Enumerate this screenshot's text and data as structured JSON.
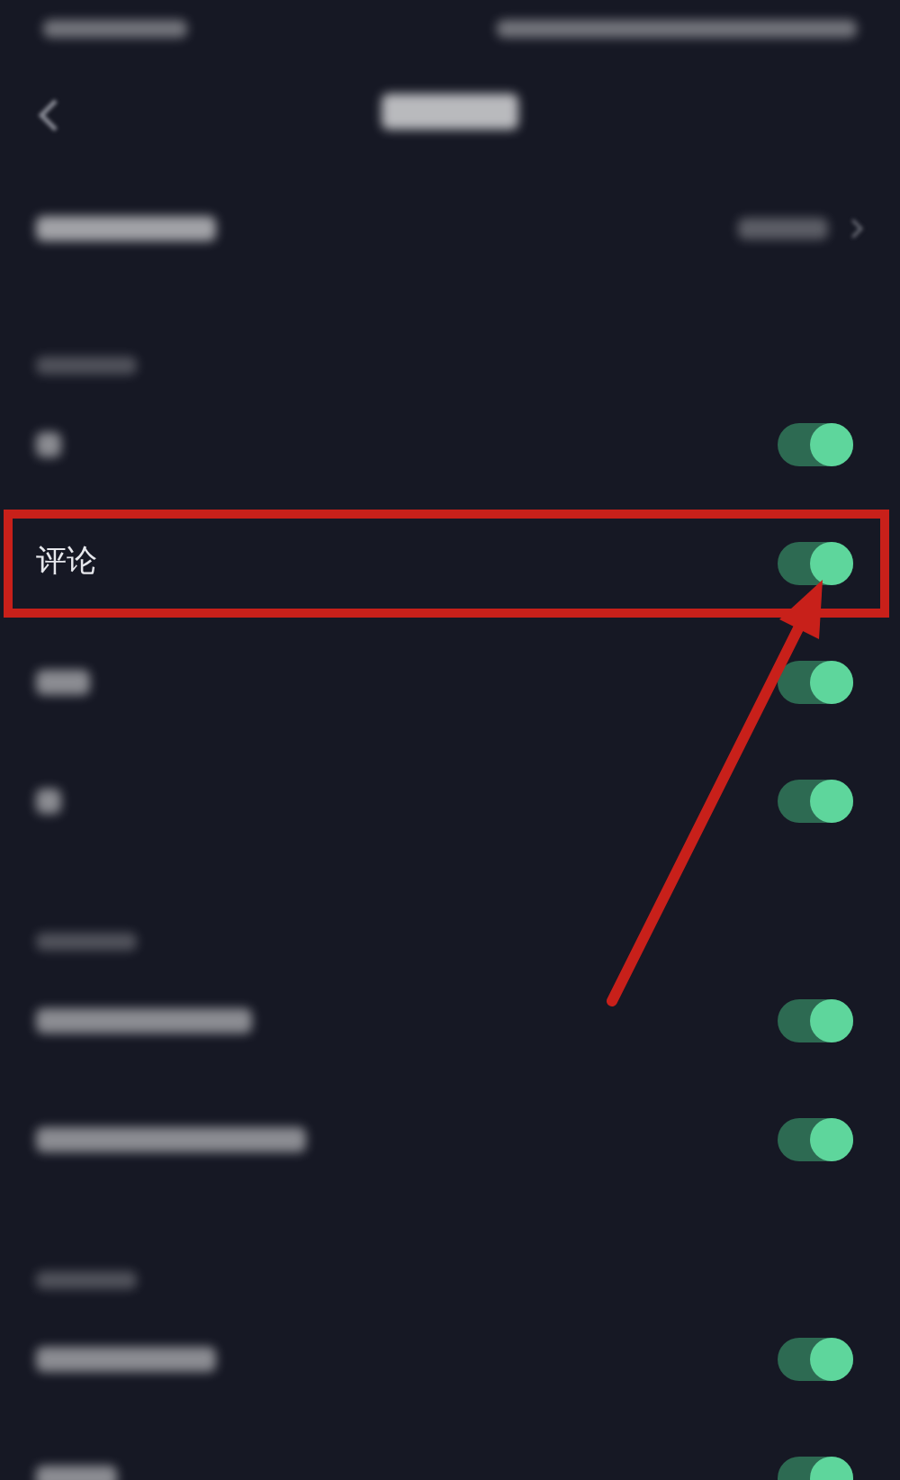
{
  "rows": [
    {
      "kind": "link"
    },
    {
      "kind": "section"
    },
    {
      "kind": "setting",
      "on": true,
      "highlighted": false
    },
    {
      "kind": "setting",
      "label": "评论",
      "on": true,
      "highlighted": true
    },
    {
      "kind": "setting",
      "on": true,
      "highlighted": false
    },
    {
      "kind": "setting",
      "on": true,
      "highlighted": false
    },
    {
      "kind": "section"
    },
    {
      "kind": "setting",
      "on": true,
      "highlighted": false
    },
    {
      "kind": "setting",
      "on": true,
      "highlighted": false
    },
    {
      "kind": "section"
    },
    {
      "kind": "setting",
      "on": true,
      "highlighted": false
    },
    {
      "kind": "setting",
      "on": true,
      "highlighted": false
    }
  ]
}
